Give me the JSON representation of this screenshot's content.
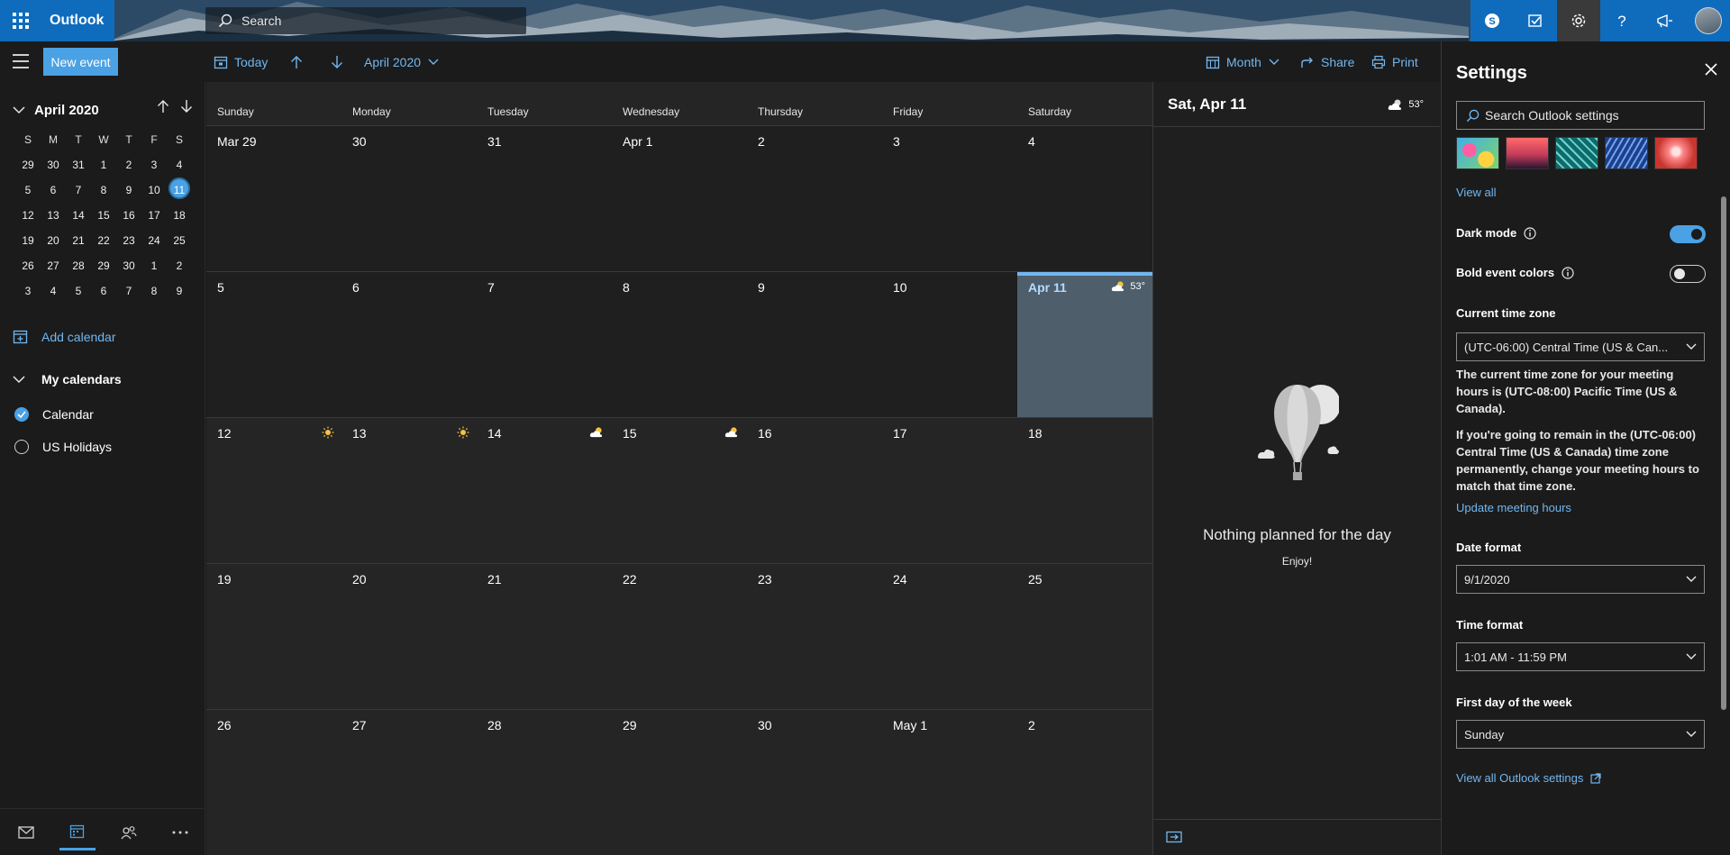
{
  "app": {
    "name": "Outlook"
  },
  "search": {
    "placeholder": "Search"
  },
  "toolbar": {
    "new_event": "New event",
    "today": "Today",
    "month_label": "April 2020",
    "view": "Month",
    "share": "Share",
    "print": "Print"
  },
  "mini_calendar": {
    "title": "April 2020",
    "weekday_initials": [
      "S",
      "M",
      "T",
      "W",
      "T",
      "F",
      "S"
    ],
    "weeks": [
      [
        "29",
        "30",
        "31",
        "1",
        "2",
        "3",
        "4"
      ],
      [
        "5",
        "6",
        "7",
        "8",
        "9",
        "10",
        "11"
      ],
      [
        "12",
        "13",
        "14",
        "15",
        "16",
        "17",
        "18"
      ],
      [
        "19",
        "20",
        "21",
        "22",
        "23",
        "24",
        "25"
      ],
      [
        "26",
        "27",
        "28",
        "29",
        "30",
        "1",
        "2"
      ],
      [
        "3",
        "4",
        "5",
        "6",
        "7",
        "8",
        "9"
      ]
    ],
    "selected": "11"
  },
  "sidebar": {
    "add_calendar": "Add calendar",
    "my_calendars": "My calendars",
    "calendars": [
      {
        "label": "Calendar",
        "checked": true
      },
      {
        "label": "US Holidays",
        "checked": false
      }
    ]
  },
  "month": {
    "weekdays": [
      "Sunday",
      "Monday",
      "Tuesday",
      "Wednesday",
      "Thursday",
      "Friday",
      "Saturday"
    ],
    "weeks": [
      [
        {
          "label": "Mar 29",
          "past": true
        },
        {
          "label": "30",
          "past": true
        },
        {
          "label": "31",
          "past": true
        },
        {
          "label": "Apr 1",
          "past": true
        },
        {
          "label": "2",
          "past": true
        },
        {
          "label": "3",
          "past": true
        },
        {
          "label": "4",
          "past": true
        }
      ],
      [
        {
          "label": "5",
          "past": true
        },
        {
          "label": "6",
          "past": true
        },
        {
          "label": "7",
          "past": true
        },
        {
          "label": "8",
          "past": true
        },
        {
          "label": "9",
          "past": true
        },
        {
          "label": "10",
          "past": true
        },
        {
          "label": "Apr 11",
          "today": true,
          "weather": "partly-cloudy",
          "temp": "53°"
        }
      ],
      [
        {
          "label": "12",
          "weather": "sunny"
        },
        {
          "label": "13",
          "weather": "sunny"
        },
        {
          "label": "14",
          "weather": "partly-cloudy"
        },
        {
          "label": "15",
          "weather": "partly-cloudy"
        },
        {
          "label": "16"
        },
        {
          "label": "17"
        },
        {
          "label": "18"
        }
      ],
      [
        {
          "label": "19"
        },
        {
          "label": "20"
        },
        {
          "label": "21"
        },
        {
          "label": "22"
        },
        {
          "label": "23"
        },
        {
          "label": "24"
        },
        {
          "label": "25"
        }
      ],
      [
        {
          "label": "26"
        },
        {
          "label": "27"
        },
        {
          "label": "28"
        },
        {
          "label": "29"
        },
        {
          "label": "30"
        },
        {
          "label": "May 1"
        },
        {
          "label": "2"
        }
      ]
    ]
  },
  "day_pane": {
    "date": "Sat, Apr 11",
    "temp": "53°",
    "empty_title": "Nothing planned for the day",
    "empty_subtitle": "Enjoy!"
  },
  "settings": {
    "title": "Settings",
    "search_placeholder": "Search Outlook settings",
    "view_all_themes": "View all",
    "dark_mode": "Dark mode",
    "dark_mode_on": true,
    "bold_event_colors": "Bold event colors",
    "bold_event_colors_on": false,
    "time_zone_label": "Current time zone",
    "time_zone_value": "(UTC-06:00) Central Time (US & Can...",
    "tz_note_1": "The current time zone for your meeting hours is (UTC-08:00) Pacific Time (US & Canada).",
    "tz_note_2": "If you're going to remain in the (UTC-06:00) Central Time (US & Canada) time zone permanently, change your meeting hours to match that time zone.",
    "update_meeting_hours": "Update meeting hours",
    "date_format_label": "Date format",
    "date_format_value": "9/1/2020",
    "time_format_label": "Time format",
    "time_format_value": "1:01 AM - 11:59 PM",
    "first_day_label": "First day of the week",
    "first_day_value": "Sunday",
    "view_all_settings": "View all Outlook settings"
  },
  "colors": {
    "accent": "#4aa1e3",
    "link": "#71b7f1",
    "brand": "#0f6cbd",
    "today_cell": "#4e5e6b"
  }
}
